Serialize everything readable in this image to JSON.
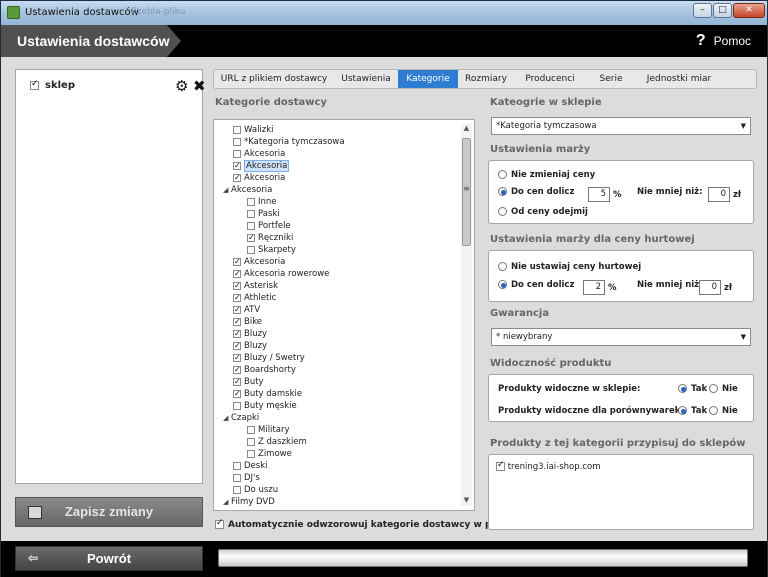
{
  "window": {
    "title": "Ustawienia dostawców",
    "ghost_tab": "Ezebla-pliku",
    "min": "–",
    "max": "□",
    "close": "✕"
  },
  "header": {
    "title": "Ustawienia dostawców",
    "help_icon": "?",
    "help_label": "Pomoc"
  },
  "left": {
    "shop_label": "sklep",
    "save_label": "Zapisz zmiany"
  },
  "tabs": [
    "URL z plikiem dostawcy",
    "Ustawienia",
    "Kategorie",
    "Rozmiary",
    "Producenci",
    "Serie",
    "Jednostki miar"
  ],
  "active_tab": "Kategorie",
  "supplier_categories": {
    "heading": "Kategorie dostawcy",
    "nodes": [
      {
        "label": "Walizki",
        "checked": false,
        "level": 1
      },
      {
        "label": "*Kategoria tymczasowa",
        "checked": false,
        "level": 1
      },
      {
        "label": "Akcesoria",
        "checked": false,
        "level": 1
      },
      {
        "label": "Akcesoria",
        "checked": true,
        "level": 1,
        "selected": true
      },
      {
        "label": "Akcesoria",
        "checked": true,
        "level": 1
      },
      {
        "label": "Akcesoria",
        "level": 0,
        "expander": true
      },
      {
        "label": "Inne",
        "checked": false,
        "level": 2
      },
      {
        "label": "Paski",
        "checked": false,
        "level": 2
      },
      {
        "label": "Portfele",
        "checked": false,
        "level": 2
      },
      {
        "label": "Ręczniki",
        "checked": true,
        "level": 2
      },
      {
        "label": "Skarpety",
        "checked": false,
        "level": 2
      },
      {
        "label": "Akcesoria",
        "checked": true,
        "level": 1
      },
      {
        "label": "Akcesoria rowerowe",
        "checked": true,
        "level": 1
      },
      {
        "label": "Asterisk",
        "checked": true,
        "level": 1
      },
      {
        "label": "Athletic",
        "checked": true,
        "level": 1
      },
      {
        "label": "ATV",
        "checked": true,
        "level": 1
      },
      {
        "label": "Bike",
        "checked": true,
        "level": 1
      },
      {
        "label": "Bluzy",
        "checked": true,
        "level": 1
      },
      {
        "label": "Bluzy",
        "checked": true,
        "level": 1
      },
      {
        "label": "Bluzy / Swetry",
        "checked": true,
        "level": 1
      },
      {
        "label": "Boardshorty",
        "checked": true,
        "level": 1
      },
      {
        "label": "Buty",
        "checked": true,
        "level": 1
      },
      {
        "label": "Buty damskie",
        "checked": true,
        "level": 1
      },
      {
        "label": "Buty męskie",
        "checked": false,
        "level": 1
      },
      {
        "label": "Czapki",
        "level": 0,
        "expander": true
      },
      {
        "label": "Military",
        "checked": false,
        "level": 2
      },
      {
        "label": "Z daszkiem",
        "checked": false,
        "level": 2
      },
      {
        "label": "Zimowe",
        "checked": false,
        "level": 2
      },
      {
        "label": "Deski",
        "checked": false,
        "level": 1
      },
      {
        "label": "DJ's",
        "checked": false,
        "level": 1
      },
      {
        "label": "Do uszu",
        "checked": false,
        "level": 1
      },
      {
        "label": "Filmy DVD",
        "level": 0,
        "expander": true
      }
    ],
    "auto_label": "Automatycznie odwzorowuj kategorie dostawcy w panelu"
  },
  "shop_categories": {
    "heading": "Kateogrie w sklepie",
    "selected": "*Kategoria tymczasowa"
  },
  "margin": {
    "heading": "Ustawienia marży",
    "opt1": "Nie zmieniaj ceny",
    "opt2": "Do cen dolicz",
    "opt3": "Od ceny odejmij",
    "value": "5",
    "pct": "%",
    "min_label": "Nie mniej niż:",
    "min_value": "0",
    "currency": "zł"
  },
  "wholesale": {
    "heading": "Ustawienia marży dla ceny hurtowej",
    "opt1": "Nie ustawiaj ceny hurtowej",
    "opt2": "Do cen dolicz",
    "value": "2",
    "pct": "%",
    "min_label": "Nie mniej niż:",
    "min_value": "0",
    "currency": "zł"
  },
  "warranty": {
    "heading": "Gwarancja",
    "selected": "* niewybrany"
  },
  "visibility": {
    "heading": "Widoczność produktu",
    "row1": "Produkty widoczne w sklepie:",
    "row2": "Produkty widoczne dla porównywarek:",
    "yes": "Tak",
    "no": "Nie"
  },
  "assign": {
    "heading": "Produkty z tej kategorii przypisuj do sklepów",
    "shop": "trening3.iai-shop.com"
  },
  "footer": {
    "back_label": "Powrót"
  }
}
